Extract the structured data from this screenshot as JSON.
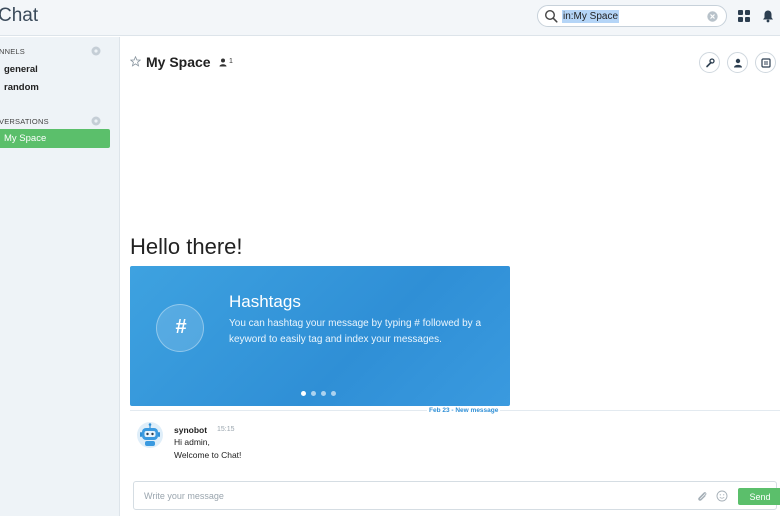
{
  "app": {
    "title": "Chat"
  },
  "search": {
    "value": "in:My Space"
  },
  "sidebar": {
    "channels_title": "NNELS",
    "channels": [
      {
        "label": "general"
      },
      {
        "label": "random"
      }
    ],
    "conversations_title": "VERSATIONS",
    "conversations": [
      {
        "label": "My Space",
        "active": true
      }
    ]
  },
  "room": {
    "title": "My Space",
    "member_count": "1"
  },
  "welcome": {
    "heading": "Hello there!",
    "carousel": {
      "title": "Hashtags",
      "icon_glyph": "#",
      "text": "You can hashtag your message by typing # followed by a keyword to easily tag and index your messages.",
      "active_slide": 1,
      "slide_count": 4
    }
  },
  "divider": {
    "label": "Feb 23 - New message"
  },
  "messages": [
    {
      "author": "synobot",
      "time": "15:15",
      "lines": [
        "Hi admin,",
        "Welcome to Chat!"
      ]
    }
  ],
  "composer": {
    "placeholder": "Write your message",
    "send_label": "Send"
  },
  "colors": {
    "accent_green": "#5bbf6b",
    "carousel_blue": "#2f8fd6",
    "sidebar_bg": "#eef3f7"
  }
}
